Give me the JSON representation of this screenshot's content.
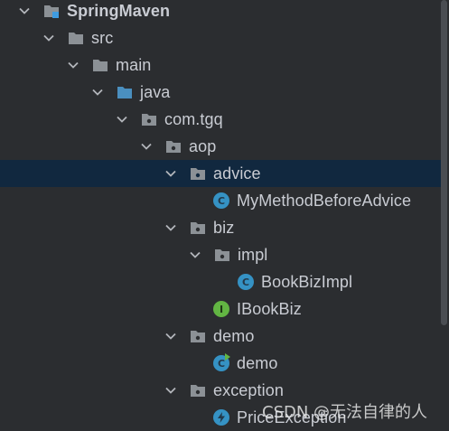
{
  "tree": {
    "nodes": [
      {
        "label": "SpringMaven",
        "type": "module",
        "expanded": true,
        "bold": true
      },
      {
        "label": "src",
        "type": "folder",
        "expanded": true
      },
      {
        "label": "main",
        "type": "folder",
        "expanded": true
      },
      {
        "label": "java",
        "type": "source-folder",
        "expanded": true
      },
      {
        "label": "com.tgq",
        "type": "package",
        "expanded": true
      },
      {
        "label": "aop",
        "type": "package",
        "expanded": true
      },
      {
        "label": "advice",
        "type": "package",
        "expanded": true,
        "selected": true
      },
      {
        "label": "MyMethodBeforeAdvice",
        "type": "class"
      },
      {
        "label": "biz",
        "type": "package",
        "expanded": true
      },
      {
        "label": "impl",
        "type": "package",
        "expanded": true
      },
      {
        "label": "BookBizImpl",
        "type": "class"
      },
      {
        "label": "IBookBiz",
        "type": "interface"
      },
      {
        "label": "demo",
        "type": "package",
        "expanded": true
      },
      {
        "label": "demo",
        "type": "main-class"
      },
      {
        "label": "exception",
        "type": "package",
        "expanded": true
      },
      {
        "label": "PriceException",
        "type": "exception-class"
      }
    ]
  },
  "watermark": "CSDN @无法自律的人",
  "colors": {
    "background": "#2b2d30",
    "selection": "#11283f",
    "text": "#c9ccd3",
    "folder": "#8c9196",
    "source_folder": "#4a8fbf",
    "class": "#3592c4",
    "interface": "#62b543"
  }
}
